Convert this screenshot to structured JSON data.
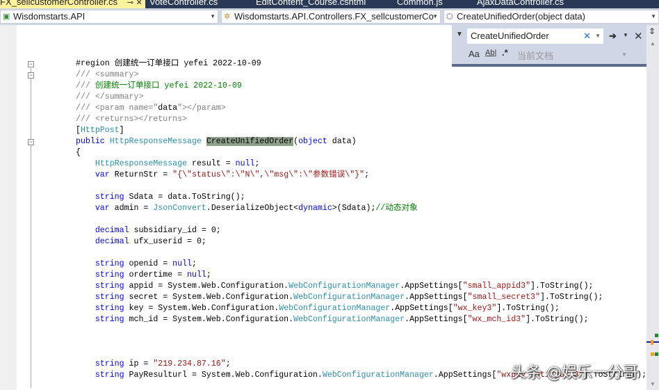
{
  "tabs": [
    {
      "label": "FX_sellcustomerController.cs",
      "pin": "⊸",
      "close": "✕",
      "active": true
    },
    {
      "label": "VoteController.cs"
    },
    {
      "label": "EditContent_Course.cshtml"
    },
    {
      "label": "Common.js"
    },
    {
      "label": "AjaxDataController.cs"
    }
  ],
  "navbar": {
    "project": "Wisdomstarts.API",
    "class": "Wisdomstarts.API.Controllers.FX_sellcustomerCo",
    "member": "CreateUnifiedOrder(object data)"
  },
  "find": {
    "query": "CreateUnifiedOrder",
    "scope": "当前文档",
    "match_case": "Aa",
    "whole_word": "Ab|",
    "regex": ".*"
  },
  "code": [
    [
      [
        "pl",
        "#region 创建统一订单接口 yefei 2022-10-09"
      ]
    ],
    [
      [
        "dc",
        "/// <summary>"
      ]
    ],
    [
      [
        "dc",
        "/// "
      ],
      [
        "cm",
        "创建统一订单接口 yefei 2022-10-09"
      ]
    ],
    [
      [
        "dc",
        "/// </summary>"
      ]
    ],
    [
      [
        "dc",
        "/// <param name=\""
      ],
      [
        "pl",
        "data"
      ],
      [
        "dc",
        "\"></param>"
      ]
    ],
    [
      [
        "dc",
        "/// <returns></returns>"
      ]
    ],
    [
      [
        "pl",
        "["
      ],
      [
        "ty",
        "HttpPost"
      ],
      [
        "pl",
        "]"
      ]
    ],
    [
      [
        "kw",
        "public "
      ],
      [
        "ty",
        "HttpResponseMessage "
      ],
      [
        "hl",
        "CreateUnifiedOrder"
      ],
      [
        "pl",
        "("
      ],
      [
        "kw",
        "object"
      ],
      [
        "pl",
        " data)"
      ]
    ],
    [
      [
        "pl",
        "{"
      ]
    ],
    [
      [
        "pl",
        "    "
      ],
      [
        "ty",
        "HttpResponseMessage"
      ],
      [
        "pl",
        " result = "
      ],
      [
        "kw",
        "null"
      ],
      [
        "pl",
        ";"
      ]
    ],
    [
      [
        "pl",
        "    "
      ],
      [
        "kw",
        "var"
      ],
      [
        "pl",
        " ReturnStr = "
      ],
      [
        "st",
        "\"{\\\"status\\\":\\\"N\\\",\\\"msg\\\":\\\"参数错误\\\"}\""
      ],
      [
        "pl",
        ";"
      ]
    ],
    [],
    [
      [
        "pl",
        "    "
      ],
      [
        "kw",
        "string"
      ],
      [
        "pl",
        " Sdata = data.ToString();"
      ]
    ],
    [
      [
        "pl",
        "    "
      ],
      [
        "kw",
        "var"
      ],
      [
        "pl",
        " admin = "
      ],
      [
        "ty",
        "JsonConvert"
      ],
      [
        "pl",
        ".DeserializeObject<"
      ],
      [
        "kw",
        "dynamic"
      ],
      [
        "pl",
        ">(Sdata);"
      ],
      [
        "cm",
        "//动态对象"
      ]
    ],
    [],
    [
      [
        "pl",
        "    "
      ],
      [
        "kw",
        "decimal"
      ],
      [
        "pl",
        " subsidiary_id = 0;"
      ]
    ],
    [
      [
        "pl",
        "    "
      ],
      [
        "kw",
        "decimal"
      ],
      [
        "pl",
        " ufx_userid = 0;"
      ]
    ],
    [],
    [
      [
        "pl",
        "    "
      ],
      [
        "kw",
        "string"
      ],
      [
        "pl",
        " openid = "
      ],
      [
        "kw",
        "null"
      ],
      [
        "pl",
        ";"
      ]
    ],
    [
      [
        "pl",
        "    "
      ],
      [
        "kw",
        "string"
      ],
      [
        "pl",
        " ordertime = "
      ],
      [
        "kw",
        "null"
      ],
      [
        "pl",
        ";"
      ]
    ],
    [
      [
        "pl",
        "    "
      ],
      [
        "kw",
        "string"
      ],
      [
        "pl",
        " appid = System.Web.Configuration."
      ],
      [
        "ty",
        "WebConfigurationManager"
      ],
      [
        "pl",
        ".AppSettings["
      ],
      [
        "st",
        "\"small_appid3\""
      ],
      [
        "pl",
        "].ToString();"
      ]
    ],
    [
      [
        "pl",
        "    "
      ],
      [
        "kw",
        "string"
      ],
      [
        "pl",
        " secret = System.Web.Configuration."
      ],
      [
        "ty",
        "WebConfigurationManager"
      ],
      [
        "pl",
        ".AppSettings["
      ],
      [
        "st",
        "\"small_secret3\""
      ],
      [
        "pl",
        "].ToString();"
      ]
    ],
    [
      [
        "pl",
        "    "
      ],
      [
        "kw",
        "string"
      ],
      [
        "pl",
        " key = System.Web.Configuration."
      ],
      [
        "ty",
        "WebConfigurationManager"
      ],
      [
        "pl",
        ".AppSettings["
      ],
      [
        "st",
        "\"wx_key3\""
      ],
      [
        "pl",
        "].ToString();"
      ]
    ],
    [
      [
        "pl",
        "    "
      ],
      [
        "kw",
        "string"
      ],
      [
        "pl",
        " mch_id = System.Web.Configuration."
      ],
      [
        "ty",
        "WebConfigurationManager"
      ],
      [
        "pl",
        ".AppSettings["
      ],
      [
        "st",
        "\"wx_mch_id3\""
      ],
      [
        "pl",
        "].ToString();"
      ]
    ],
    [],
    [],
    [],
    [
      [
        "pl",
        "    "
      ],
      [
        "kw",
        "string"
      ],
      [
        "pl",
        " ip = "
      ],
      [
        "st",
        "\"219.234.87.16\""
      ],
      [
        "pl",
        ";"
      ]
    ],
    [
      [
        "pl",
        "    "
      ],
      [
        "kw",
        "string"
      ],
      [
        "pl",
        " PayResulturl = System.Web.Configuration."
      ],
      [
        "ty",
        "WebConfigurationManager"
      ],
      [
        "pl",
        ".AppSettings["
      ],
      [
        "st",
        "\"wxpay_notifyurl3\""
      ],
      [
        "pl",
        "].ToString();"
      ]
    ]
  ],
  "watermark": "头条 @娱乐一分哥",
  "colors": {
    "keyword": "#0000ff",
    "type": "#2b91af",
    "string": "#a31515",
    "comment": "#008000",
    "doc": "#808080",
    "active_tab": "#fff29d",
    "tab_bar": "#293955"
  }
}
